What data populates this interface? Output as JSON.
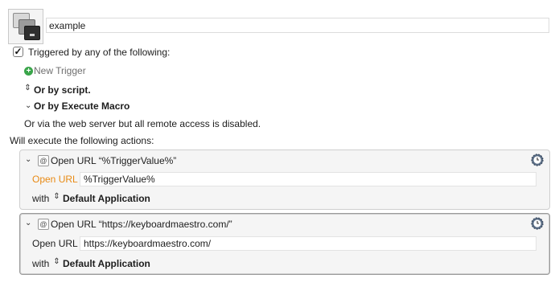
{
  "macro": {
    "name": "example"
  },
  "triggers": {
    "checkbox_checked": "✓",
    "heading": "Triggered by any of the following:",
    "new_trigger": "New Trigger",
    "script_label": "Or by script.",
    "execute_macro_label": "Or by Execute Macro",
    "web_server_note": "Or via the web server but all remote access is disabled."
  },
  "actions_heading": "Will execute the following actions:",
  "actions": [
    {
      "title": "Open URL “%TriggerValue%”",
      "field_label": "Open URL",
      "field_value": "%TriggerValue%",
      "with_label": "with",
      "application": "Default Application"
    },
    {
      "title": "Open URL “https://keyboardmaestro.com/”",
      "field_label": "Open URL",
      "field_value": "https://keyboardmaestro.com/",
      "with_label": "with",
      "application": "Default Application"
    }
  ],
  "icons": {
    "macro": "macro-windows-icon",
    "add": "plus-circle-icon",
    "stepper": "updown-stepper-icon",
    "disclosure": "chevron-down-icon",
    "action": "at-sign-icon",
    "settings": "gear-clock-icon"
  },
  "colors": {
    "add_green": "#3aa54a",
    "highlight_orange": "#e88a14",
    "panel_bg": "#f5f5f5"
  }
}
